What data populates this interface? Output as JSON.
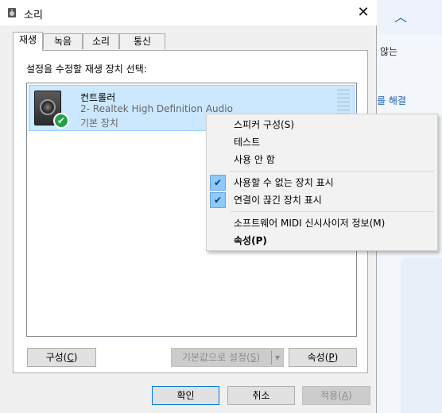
{
  "window": {
    "title": "소리"
  },
  "background": {
    "text_partial": "않는",
    "link_partial": "를 해결"
  },
  "tabs": [
    {
      "label": "재생",
      "active": true
    },
    {
      "label": "녹음",
      "active": false
    },
    {
      "label": "소리",
      "active": false
    },
    {
      "label": "통신",
      "active": false
    }
  ],
  "panel": {
    "select_label": "설정을 수정할 재생 장치 선택:",
    "device": {
      "name": "컨트롤러",
      "description": "2- Realtek High Definition Audio",
      "state": "기본 장치"
    }
  },
  "panel_buttons": {
    "configure_label": "구성",
    "configure_hotkey": "C",
    "set_default_label": "기본값으로 설정",
    "set_default_hotkey": "S",
    "properties_label": "속성",
    "properties_hotkey": "P"
  },
  "context_menu": {
    "configure_speakers": "스피커 구성(S)",
    "test": "테스트",
    "disable": "사용 안 함",
    "show_disabled": "사용할 수 없는 장치 표시",
    "show_disconnected": "연결이 끊긴 장치 표시",
    "midi_info": "소프트웨어 MIDI 신시사이저 정보(M)",
    "properties": "속성(P)"
  },
  "dialog_buttons": {
    "ok": "확인",
    "cancel": "취소",
    "apply_label": "적용",
    "apply_hotkey": "A"
  },
  "colors": {
    "accent": "#0078d7",
    "selection": "#cce8ff",
    "check_green": "#21a24a"
  },
  "icons": {
    "check": "✔",
    "close": "✕",
    "chevron_up": "︿",
    "dropdown": "▾"
  }
}
